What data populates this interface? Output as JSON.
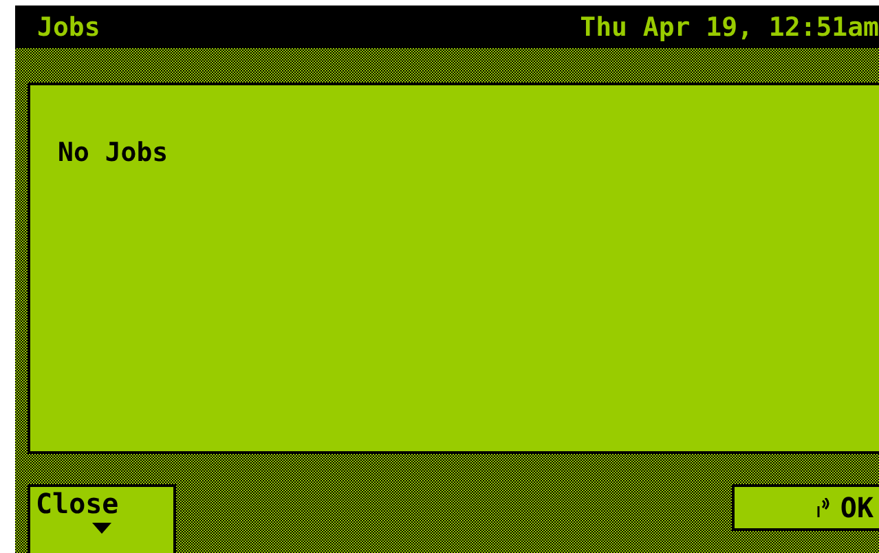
{
  "title_bar": {
    "title": "Jobs",
    "datetime": "Thu Apr 19, 12:51am"
  },
  "message": "No Jobs",
  "buttons": [
    {
      "kind": "menu",
      "label": "Close"
    },
    {
      "kind": "action",
      "label": "OK"
    }
  ]
}
